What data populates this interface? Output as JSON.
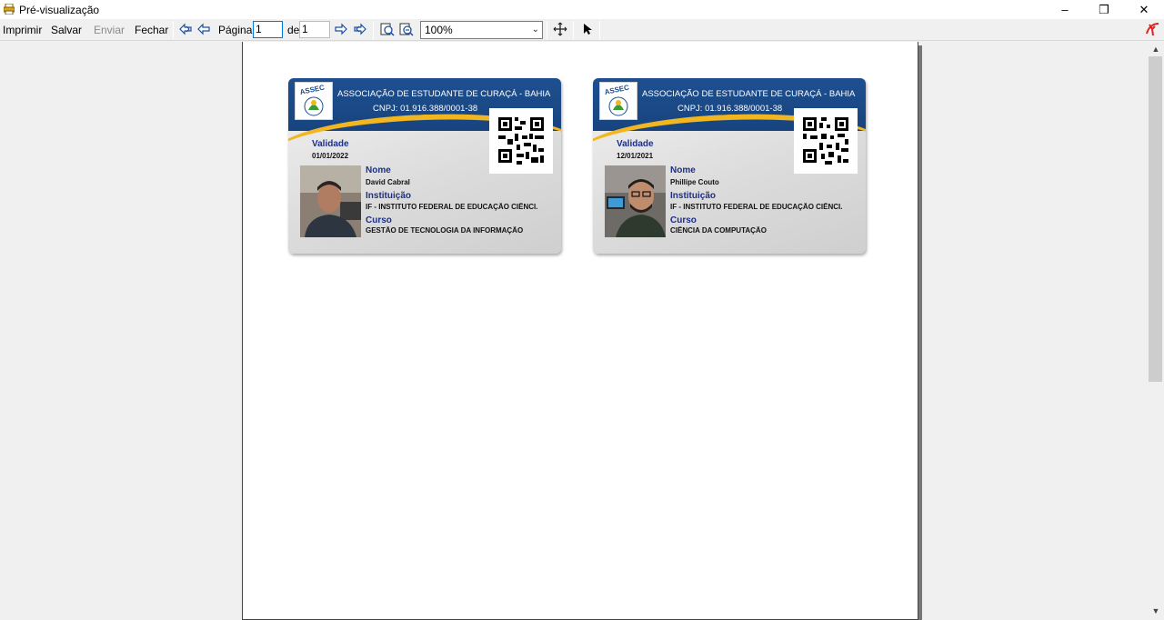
{
  "window": {
    "title": "Pré-visualização",
    "controls": {
      "minimize": "–",
      "maximize": "❐",
      "close": "✕"
    }
  },
  "toolbar": {
    "print_label": "Imprimir",
    "save_label": "Salvar",
    "send_label": "Enviar",
    "close_label": "Fechar",
    "page_label": "Página",
    "page_value": "1",
    "of_label": "de",
    "total_pages": "1",
    "zoom_value": "100%"
  },
  "cards": [
    {
      "org_name": "ASSOCIAÇÃO DE ESTUDANTE DE CURAÇÁ - BAHIA",
      "cnpj": "CNPJ: 01.916.388/0001-38",
      "logo_text": "ASSEC",
      "validity_label": "Validade",
      "validity": "01/01/2022",
      "name_label": "Nome",
      "name": "David Cabral",
      "institution_label": "Instituição",
      "institution": "IF - INSTITUTO FEDERAL DE EDUCAÇÃO CIÊNCI.",
      "course_label": "Curso",
      "course": "GESTÃO DE TECNOLOGIA DA INFORMAÇÃO"
    },
    {
      "org_name": "ASSOCIAÇÃO DE ESTUDANTE DE CURAÇÁ - BAHIA",
      "cnpj": "CNPJ: 01.916.388/0001-38",
      "logo_text": "ASSEC",
      "validity_label": "Validade",
      "validity": "12/01/2021",
      "name_label": "Nome",
      "name": "Phillipe Couto",
      "institution_label": "Instituição",
      "institution": "IF - INSTITUTO FEDERAL DE EDUCAÇÃO CIÊNCI.",
      "course_label": "Curso",
      "course": "CIÊNCIA DA COMPUTAÇÃO"
    }
  ],
  "colors": {
    "card_header": "#1e4f8f",
    "card_accent": "#f2b61f",
    "label_blue": "#1c2f86"
  }
}
